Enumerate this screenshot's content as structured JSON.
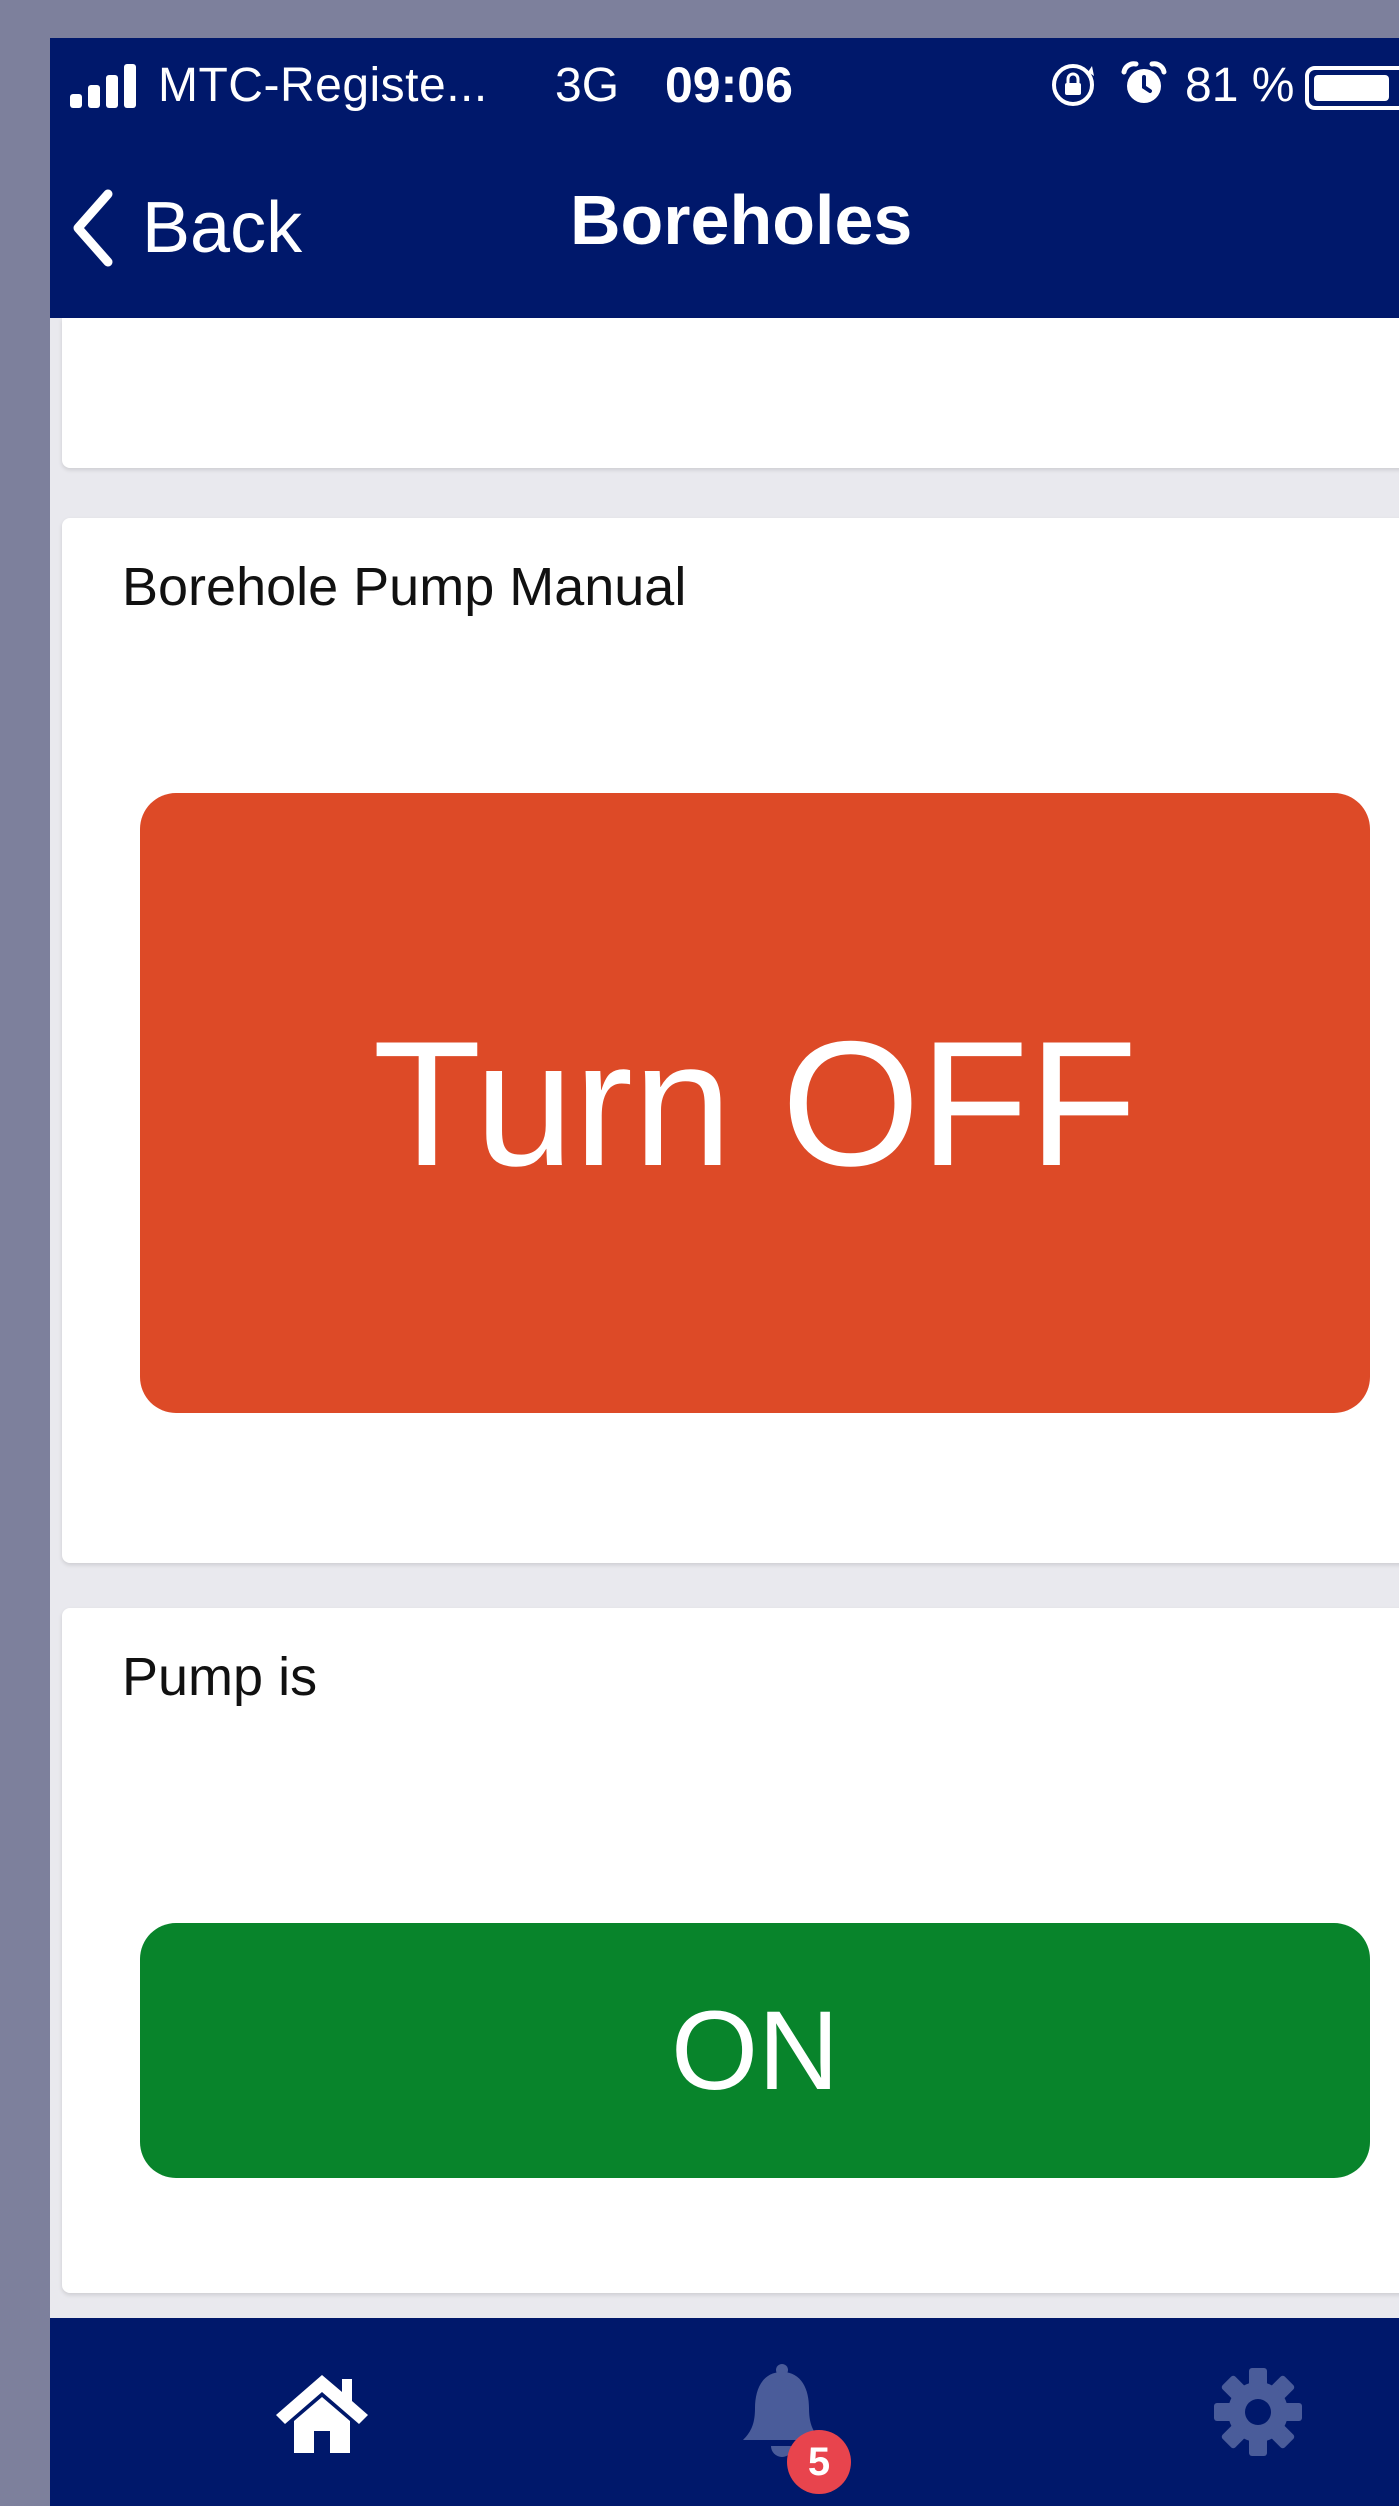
{
  "status_bar": {
    "carrier": "MTC-Registe...",
    "network": "3G",
    "time": "09:06",
    "battery_percent": "81 %",
    "battery_level": 0.81,
    "icons": [
      "signal-icon",
      "rotation-lock-icon",
      "alarm-icon",
      "battery-icon"
    ]
  },
  "nav": {
    "back_label": "Back",
    "title": "Boreholes",
    "background": "#00186b"
  },
  "cards": {
    "pump_manual": {
      "label": "Borehole Pump Manual",
      "button_label": "Turn OFF",
      "button_color": "#dd4a27"
    },
    "pump_status": {
      "label": "Pump is",
      "status_value": "ON",
      "status_color": "#08842b"
    }
  },
  "tabbar": {
    "items": [
      "home-icon",
      "bell-icon",
      "gear-icon"
    ],
    "alerts_badge": "5",
    "badge_color": "#e8444d"
  }
}
